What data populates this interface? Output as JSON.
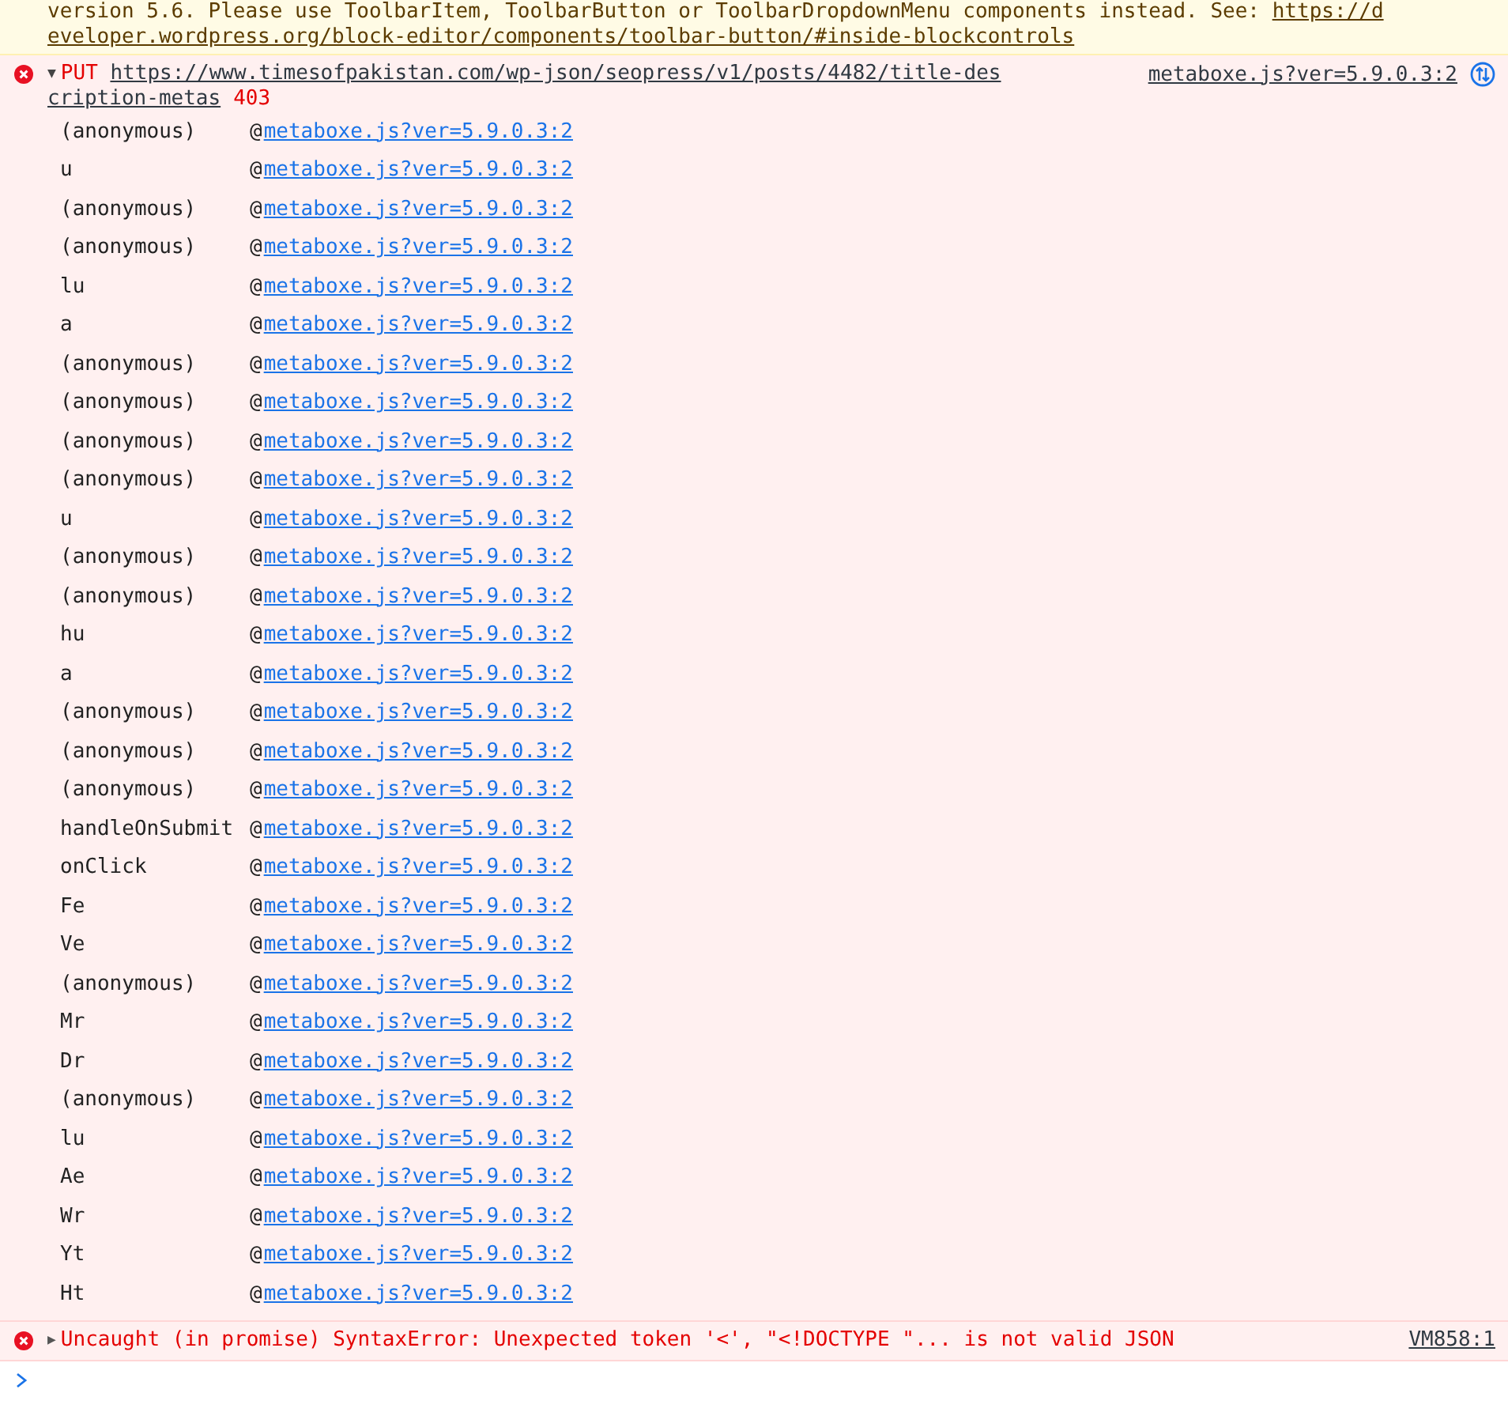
{
  "warning": {
    "text": "version 5.6. Please use ToolbarItem, ToolbarButton or ToolbarDropdownMenu components instead. See: ",
    "link": "https://d",
    "link_continued": "eveloper.wordpress.org/block-editor/components/toolbar-button/#inside-blockcontrols"
  },
  "errors": [
    {
      "expanded": true,
      "toggle": "▼",
      "method": "PUT",
      "url": "https://www.timesofpakistan.com/wp-json/seopress/v1/posts/4482/title-des",
      "url_continued": "cription-metas",
      "status": "403",
      "source": "metaboxe.js?ver=5.9.0.3:2",
      "stack": [
        {
          "fn": "(anonymous)",
          "at": "@",
          "file": "metaboxe.js?ver=5.9.0.3:2"
        },
        {
          "fn": "u",
          "at": "@",
          "file": "metaboxe.js?ver=5.9.0.3:2"
        },
        {
          "fn": "(anonymous)",
          "at": "@",
          "file": "metaboxe.js?ver=5.9.0.3:2"
        },
        {
          "fn": "(anonymous)",
          "at": "@",
          "file": "metaboxe.js?ver=5.9.0.3:2"
        },
        {
          "fn": "lu",
          "at": "@",
          "file": "metaboxe.js?ver=5.9.0.3:2"
        },
        {
          "fn": "a",
          "at": "@",
          "file": "metaboxe.js?ver=5.9.0.3:2"
        },
        {
          "fn": "(anonymous)",
          "at": "@",
          "file": "metaboxe.js?ver=5.9.0.3:2"
        },
        {
          "fn": "(anonymous)",
          "at": "@",
          "file": "metaboxe.js?ver=5.9.0.3:2"
        },
        {
          "fn": "(anonymous)",
          "at": "@",
          "file": "metaboxe.js?ver=5.9.0.3:2"
        },
        {
          "fn": "(anonymous)",
          "at": "@",
          "file": "metaboxe.js?ver=5.9.0.3:2"
        },
        {
          "fn": "u",
          "at": "@",
          "file": "metaboxe.js?ver=5.9.0.3:2"
        },
        {
          "fn": "(anonymous)",
          "at": "@",
          "file": "metaboxe.js?ver=5.9.0.3:2"
        },
        {
          "fn": "(anonymous)",
          "at": "@",
          "file": "metaboxe.js?ver=5.9.0.3:2"
        },
        {
          "fn": "hu",
          "at": "@",
          "file": "metaboxe.js?ver=5.9.0.3:2"
        },
        {
          "fn": "a",
          "at": "@",
          "file": "metaboxe.js?ver=5.9.0.3:2"
        },
        {
          "fn": "(anonymous)",
          "at": "@",
          "file": "metaboxe.js?ver=5.9.0.3:2"
        },
        {
          "fn": "(anonymous)",
          "at": "@",
          "file": "metaboxe.js?ver=5.9.0.3:2"
        },
        {
          "fn": "(anonymous)",
          "at": "@",
          "file": "metaboxe.js?ver=5.9.0.3:2"
        },
        {
          "fn": "handleOnSubmit",
          "at": "@",
          "file": "metaboxe.js?ver=5.9.0.3:2"
        },
        {
          "fn": "onClick",
          "at": "@",
          "file": "metaboxe.js?ver=5.9.0.3:2"
        },
        {
          "fn": "Fe",
          "at": "@",
          "file": "metaboxe.js?ver=5.9.0.3:2"
        },
        {
          "fn": "Ve",
          "at": "@",
          "file": "metaboxe.js?ver=5.9.0.3:2"
        },
        {
          "fn": "(anonymous)",
          "at": "@",
          "file": "metaboxe.js?ver=5.9.0.3:2"
        },
        {
          "fn": "Mr",
          "at": "@",
          "file": "metaboxe.js?ver=5.9.0.3:2"
        },
        {
          "fn": "Dr",
          "at": "@",
          "file": "metaboxe.js?ver=5.9.0.3:2"
        },
        {
          "fn": "(anonymous)",
          "at": "@",
          "file": "metaboxe.js?ver=5.9.0.3:2"
        },
        {
          "fn": "lu",
          "at": "@",
          "file": "metaboxe.js?ver=5.9.0.3:2"
        },
        {
          "fn": "Ae",
          "at": "@",
          "file": "metaboxe.js?ver=5.9.0.3:2"
        },
        {
          "fn": "Wr",
          "at": "@",
          "file": "metaboxe.js?ver=5.9.0.3:2"
        },
        {
          "fn": "Yt",
          "at": "@",
          "file": "metaboxe.js?ver=5.9.0.3:2"
        },
        {
          "fn": "Ht",
          "at": "@",
          "file": "metaboxe.js?ver=5.9.0.3:2"
        }
      ]
    },
    {
      "expanded": false,
      "toggle": "▶",
      "message": "Uncaught (in promise) SyntaxError: Unexpected token '<', \"<!DOCTYPE \"... is not valid JSON",
      "source": "VM858:1"
    }
  ]
}
